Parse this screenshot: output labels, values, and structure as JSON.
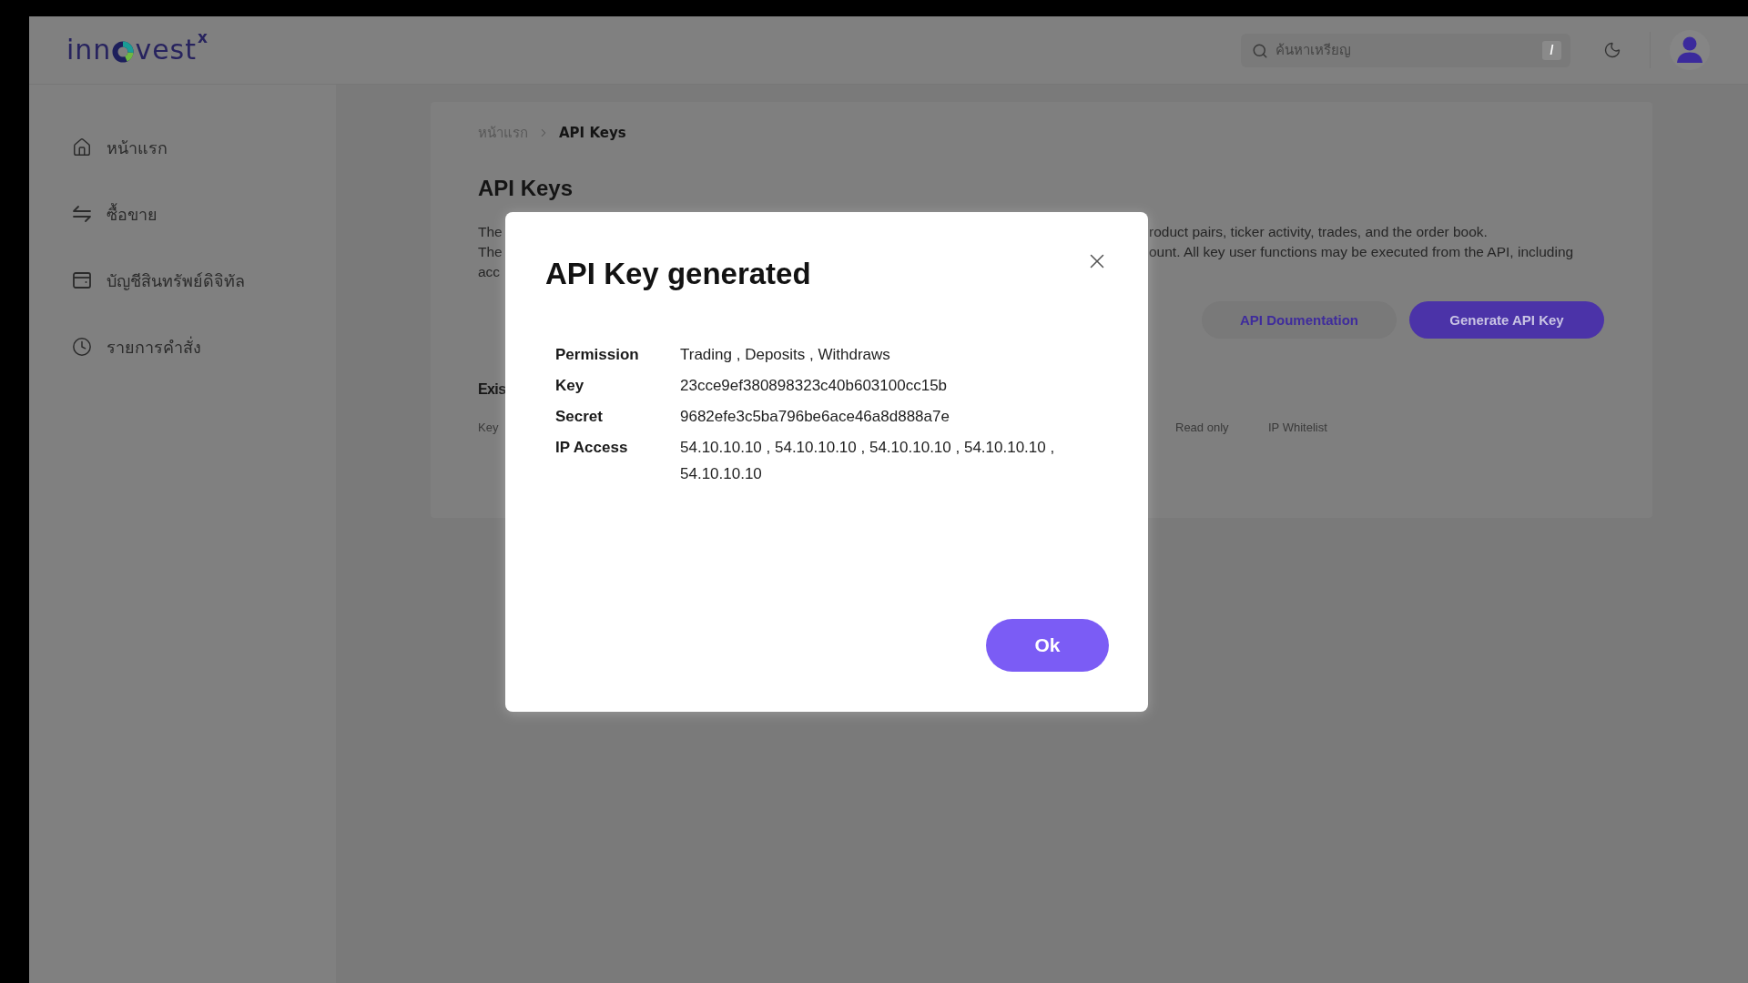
{
  "header": {
    "logo": {
      "prefix": "inn",
      "suffix": "vest",
      "superscript": "x"
    },
    "search": {
      "placeholder": "ค้นหาเหรียญ",
      "shortcut": "/"
    }
  },
  "sidebar": {
    "items": [
      {
        "kind": "home",
        "label": "หน้าแรก"
      },
      {
        "kind": "trade",
        "label": "ซื้อขาย"
      },
      {
        "kind": "wallet",
        "label": "บัญชีสินทรัพย์ดิจิทัล"
      },
      {
        "kind": "history",
        "label": "รายการคำสั่ง"
      }
    ]
  },
  "breadcrumb": [
    {
      "label": "หน้าแรก",
      "current": false
    },
    {
      "label": "API Keys",
      "current": true
    }
  ],
  "page": {
    "title": "API Keys",
    "description_lines": [
      {
        "start": "The",
        "end": "roduct pairs, ticker activity, trades, and the order book."
      },
      {
        "start": "The",
        "end": "ount. All key user functions may be executed from the API, including"
      },
      {
        "start": "acc"
      }
    ],
    "buttons": [
      {
        "kind": "secondary",
        "label": "API Doumentation"
      },
      {
        "kind": "primary",
        "label": "Generate API Key"
      }
    ],
    "existing_keys": {
      "title": "Exis",
      "columns": [
        "Key",
        "Read only",
        "IP Whitelist"
      ]
    }
  },
  "dialog": {
    "title": "API Key generated",
    "fields": [
      {
        "label": "Permission",
        "value": "Trading , Deposits , Withdraws"
      },
      {
        "label": "Key",
        "value": "23cce9ef380898323c40b603100cc15b"
      },
      {
        "label": "Secret",
        "value": "9682efe3c5ba796be6ace46a8d888a7e"
      },
      {
        "label": "IP Access",
        "value": "54.10.10.10 , 54.10.10.10 , 54.10.10.10 , 54.10.10.10 , 54.10.10.10"
      }
    ],
    "confirm": "Ok"
  }
}
